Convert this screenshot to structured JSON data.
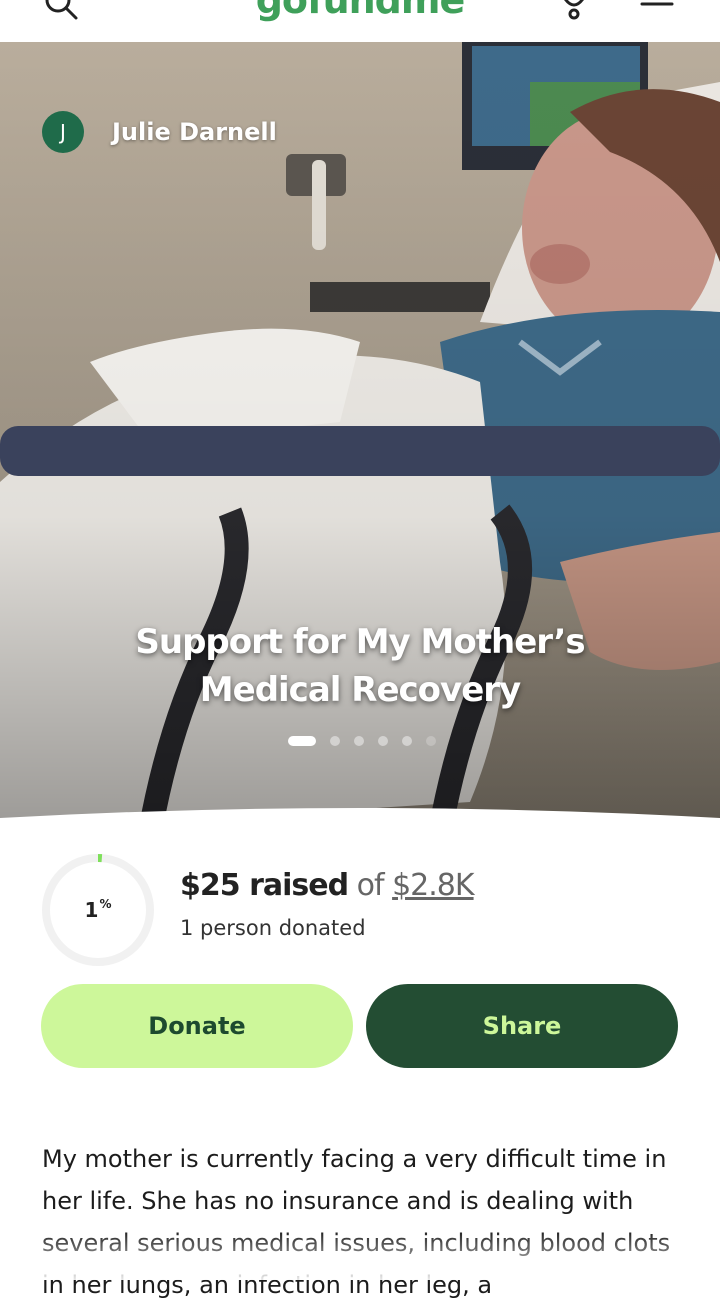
{
  "header": {
    "brand": "gofundme",
    "icons": [
      "search-icon",
      "bell-icon",
      "menu-icon"
    ]
  },
  "campaign": {
    "organizer_initial": "J",
    "organizer_name": "Julie Darnell",
    "title_line1": "Support for My Mother’s",
    "title_line2": "Medical Recovery",
    "slides_total": 6,
    "slide_active": 1
  },
  "progress": {
    "percent_number": "1",
    "percent_sign": "%",
    "fraction": 0.01,
    "raised": "$25 raised",
    "of": "of",
    "goal": "$2.8K",
    "donors": "1 person donated"
  },
  "buttons": {
    "donate": "Donate",
    "share": "Share"
  },
  "story": {
    "text": "My mother is currently facing a very difficult time in her life. She has no insurance and is dealing with several serious medical issues, including blood clots in her lungs, an infection in her leg, a"
  },
  "colors": {
    "brand": "#3fa05a",
    "donate_bg": "#cdf79a",
    "share_bg": "#234d33",
    "progress": "#7ee05a",
    "avatar": "#1f6b4a"
  }
}
